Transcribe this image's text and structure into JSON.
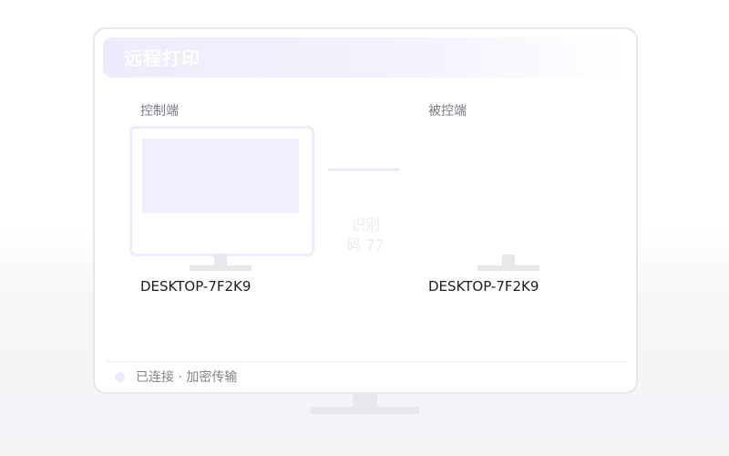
{
  "window": {
    "title": "远程打印"
  },
  "controller": {
    "label": "控制端",
    "device_name": "DESKTOP-7F2K9"
  },
  "controlled": {
    "label": "被控端",
    "device_name": "DESKTOP-7F2K9"
  },
  "link": {
    "code_text": "识别\n码 77"
  },
  "status": {
    "text": "已连接 · 加密传输"
  },
  "colors": {
    "accent": "#efebfd",
    "screen": "#f1effd",
    "stand": "#e6e8ec",
    "frame_border": "#e6e6ec"
  },
  "icons": {
    "arrow": "arrow-right-icon",
    "status_dot": "status-dot-icon"
  }
}
